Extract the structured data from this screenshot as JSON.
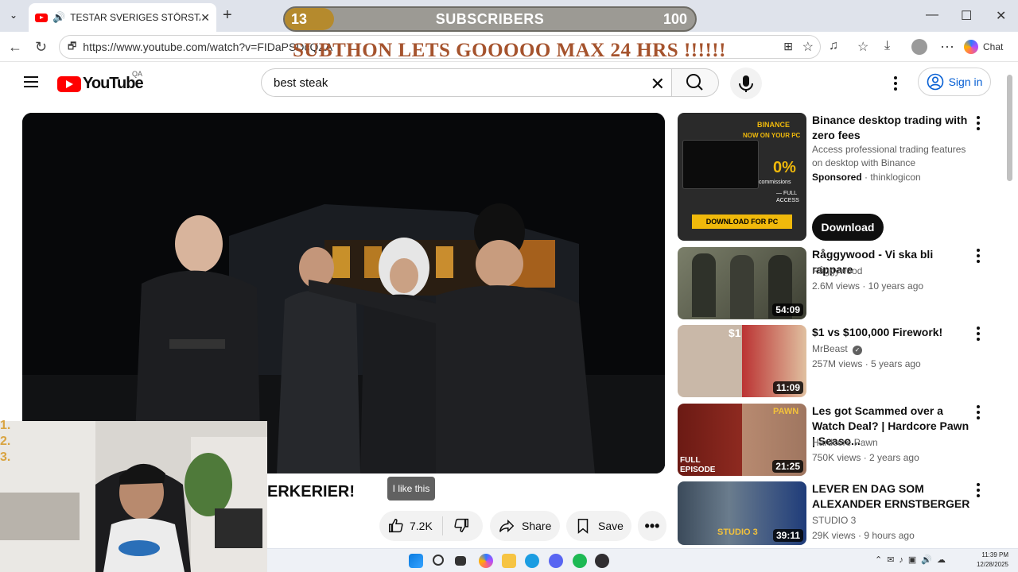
{
  "browser": {
    "tab_title": "TESTAR SVERIGES STÖRSTA F...",
    "url": "https://www.youtube.com/watch?v=FIDaPSDcQZA",
    "chat_label": "Chat"
  },
  "overlay": {
    "sub_count": "13",
    "sub_label": "SUBSCRIBERS",
    "sub_goal": "100",
    "subthon_text": "SUBTHON LETS GOOOOO MAX 24 HRS  !!!!!!",
    "list_numbers": [
      "1.",
      "2.",
      "3."
    ]
  },
  "youtube": {
    "logo_text": "YouTube",
    "country_code": "QA",
    "search_value": "best steak",
    "signin_label": "Sign in"
  },
  "video": {
    "title_visible": "ERKERIER!",
    "tooltip": "I like this",
    "likes": "7.2K",
    "share_label": "Share",
    "save_label": "Save"
  },
  "ad": {
    "title": "Binance desktop trading with zero fees",
    "desc": "Access professional trading features on desktop with Binance",
    "sponsored": "Sponsored",
    "advertiser": "thinklogicon",
    "button": "Download",
    "thumb_brand": "BINANCE",
    "thumb_sub": "NOW ON YOUR PC",
    "thumb_pct": "0%",
    "thumb_commissions": "commissions",
    "thumb_full": "— FULL",
    "thumb_access": "ACCESS",
    "thumb_cta": "DOWNLOAD FOR PC"
  },
  "related": [
    {
      "title": "Råggywood - Vi ska bli rappare",
      "channel": "Råggywood",
      "meta": "2.6M views · 10 years ago",
      "duration": "54:09"
    },
    {
      "title": "$1 vs $100,000 Firework!",
      "channel": "MrBeast",
      "meta": "257M views · 5 years ago",
      "duration": "11:09",
      "thumb_label": "$1"
    },
    {
      "title": "Les got Scammed over a Watch Deal? | Hardcore Pawn | Seaso...",
      "channel": "Hardcore Pawn",
      "meta": "750K views · 2 years ago",
      "duration": "21:25",
      "thumb_label": "FULL EPISODE",
      "thumb_brand": "PAWN"
    },
    {
      "title": "LEVER EN DAG SOM ALEXANDER ERNSTBERGER",
      "channel": "STUDIO 3",
      "meta": "29K views · 9 hours ago",
      "duration": "39:11",
      "thumb_label": "STUDIO 3"
    }
  ],
  "taskbar": {
    "time": "11:39 PM",
    "date": "12/28/2025"
  }
}
